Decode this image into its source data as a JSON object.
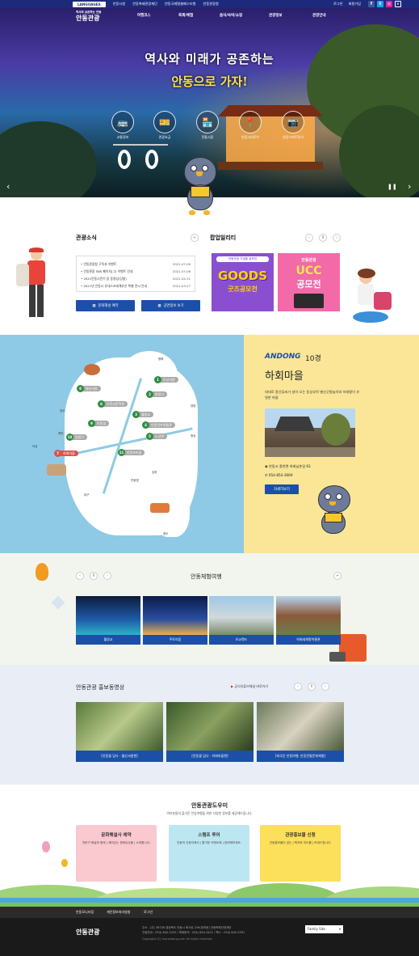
{
  "topbar": {
    "language": "LANGUAGES",
    "links": [
      "안동시청",
      "안동축제관광재단",
      "안동국제탈춤페스티벌",
      "안동관광청"
    ],
    "login": "로그인",
    "signup": "회원가입"
  },
  "nav": {
    "logo_small": "역사와 공존하는 안동",
    "logo": "안동관광",
    "menus": [
      "여행코스",
      "축제/체험",
      "음식/숙박/쇼핑",
      "관광정보",
      "관광안내"
    ]
  },
  "hero": {
    "slogan_line1": "역사와 미래가 공존하는",
    "slogan_line2": "안동으로 가자!",
    "quicklinks": [
      "교통정보",
      "관광요금",
      "전통시장",
      "안동시티투어",
      "안동스마트투어"
    ],
    "swing_text": "OO"
  },
  "news": {
    "title": "관광소식",
    "items": [
      {
        "text": "• 안동관광청 구독과 이벤트",
        "date": "2021-07-09"
      },
      {
        "text": "• 안동관광 SNS 페이지(그) 이벤트 안내",
        "date": "2021-07-06"
      },
      {
        "text": "• 2021안동시민기 달 동영상(당첨)",
        "date": "2021-05-31"
      },
      {
        "text": "• 2021년 안동시 유네스코세계유산 특별 전시 안내",
        "date": "2021-03-27"
      }
    ],
    "btn_culture": "문화해설 예약",
    "btn_promo": "공연정보 보기"
  },
  "popup": {
    "title": "팝업일리티",
    "banner1_top": "안동관광 기념품 공모전",
    "banner1_main": "GOODS",
    "banner1_sub": "굿즈공모전",
    "banner2_top": "안동관광",
    "banner2_main": "UCC",
    "banner2_sub": "공모전"
  },
  "map": {
    "pins": [
      {
        "n": "1",
        "label": "도산서원"
      },
      {
        "n": "2",
        "label": "봉정사"
      },
      {
        "n": "3",
        "label": "월영교"
      },
      {
        "n": "4",
        "label": "안동민속박물관"
      },
      {
        "n": "5",
        "label": "도산면"
      },
      {
        "n": "6",
        "label": "이육사문학관"
      },
      {
        "n": "7",
        "label": "하회마을"
      },
      {
        "n": "8",
        "label": "병산서원"
      },
      {
        "n": "9",
        "label": "안동댐"
      },
      {
        "n": "10",
        "label": "임청각"
      },
      {
        "n": "11",
        "label": "안동포마을"
      }
    ],
    "places": [
      "봉화",
      "영주",
      "예천",
      "의성",
      "청송",
      "영양",
      "안동댐",
      "임하",
      "대구",
      "청도"
    ]
  },
  "spot": {
    "brand": "ANDONG",
    "rank": "10경",
    "name": "하회마을",
    "desc": "대대로 풍산류씨가 살아 오는 동성부락 별신굿탈놀이와 하회탈이 유명한 마을",
    "address": "안동시 풍천면 하회남촌길 63",
    "phone": "054-854-3669",
    "more": "자세히보기"
  },
  "experience": {
    "title": "안동체험여행",
    "cards": [
      "월영교",
      "주토피움",
      "유교랜드",
      "하회세계탈박물관"
    ]
  },
  "video": {
    "title": "안동관광 홍보동영상",
    "youtube": "공식유튜브채널 바로가기",
    "cards": [
      "[안동을 담다 - 월산서원편]",
      "[안동을 담다 - 하회마을편]",
      "[외국인 안동여행, 안동전통문화체험]"
    ]
  },
  "guide": {
    "title": "안동관광도우미",
    "subtitle": "여러분들의 즐거운 안동여행을 위한 다양한 정보를 제공해드립니다.",
    "boxes": [
      {
        "title": "문화해설사 예약",
        "desc": "전문가 해설과 함께 | 재미있는 문화유산을 | 소개합니다."
      },
      {
        "title": "스탬프 투어",
        "desc": "안동의 관광지에서 | 즐거운 이벤트에 | 참여해보세요."
      },
      {
        "title": "관광홍보물 신청",
        "desc": "관광홍보물이 있는 | 책자와 지도를 | 보내드립니다."
      }
    ]
  },
  "footer": {
    "links": [
      "안동모니터링",
      "개인정보처리방침",
      "로그인"
    ],
    "logo": "안동관광",
    "addr": "주소 : (우) 36708 경상북도 안동시 육사로 239(정하동) 안동축제관광재단",
    "tel": "관광안내 : 054) 840-3433 / 축제문의 : 054) 840-3421 / 팩스 : 054) 840-3391",
    "copy": "Copyright (C) tourandong.com All rights reserved.",
    "family": "Family Site"
  },
  "colors": {
    "brand": "#1d2a7c",
    "button": "#1c4fa8",
    "map_bg": "#8ecae6",
    "info_bg": "#fbe698"
  }
}
